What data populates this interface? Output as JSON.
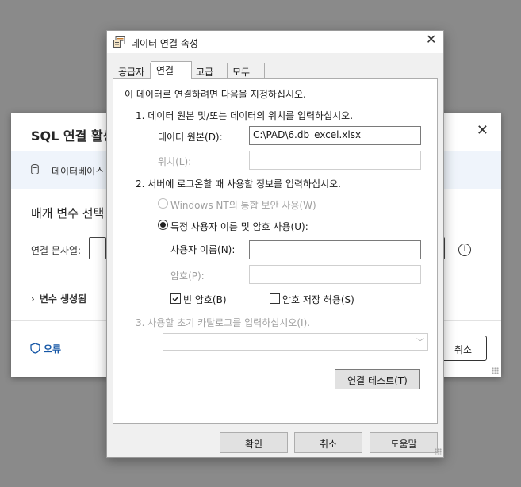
{
  "background_dialog": {
    "title": "SQL 연결 활성",
    "info_text": "데이터베이스",
    "section_title": "매개 변수 선택",
    "conn_string_label": "연결 문자열:",
    "variables_label": "변수 생성됨",
    "error_label": "오류",
    "cancel_label": "취소"
  },
  "dialog": {
    "title": "데이터 연결 속성",
    "tabs": [
      {
        "label": "공급자"
      },
      {
        "label": "연결"
      },
      {
        "label": "고급"
      },
      {
        "label": "모두"
      }
    ],
    "active_tab": "연결",
    "intro": "이 데이터로 연결하려면 다음을 지정하십시오.",
    "step1": "1. 데이터 원본 및/또는 데이터의 위치를 입력하십시오.",
    "data_source_label": "데이터 원본(D):",
    "data_source_value": "C:\\PAD\\6.db_excel.xlsx",
    "location_label": "위치(L):",
    "location_value": "",
    "step2": "2. 서버에 로그온할 때 사용할 정보를 입력하십시오.",
    "windows_nt_label": "Windows NT의 통합 보안 사용(W)",
    "specific_user_label": "특정 사용자 이름 및 암호 사용(U):",
    "username_label": "사용자 이름(N):",
    "username_value": "",
    "password_label": "암호(P):",
    "password_value": "",
    "blank_password_label": "빈 암호(B)",
    "blank_password_checked": true,
    "allow_save_password_label": "암호 저장 허용(S)",
    "allow_save_password_checked": false,
    "step3": "3. 사용할 초기 카탈로그를 입력하십시오(I).",
    "catalog_value": "",
    "test_button": "연결 테스트(T)",
    "ok_button": "확인",
    "cancel_button": "취소",
    "help_button": "도움말"
  }
}
